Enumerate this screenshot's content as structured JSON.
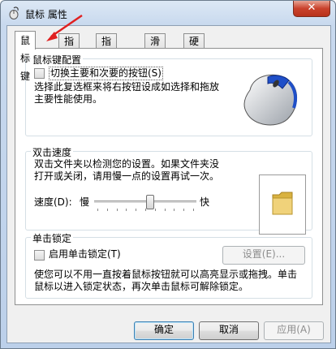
{
  "window": {
    "title": "鼠标 属性",
    "close_label": "✕"
  },
  "tabs": [
    {
      "label": "鼠标键",
      "active": true
    },
    {
      "label": "指针",
      "active": false
    },
    {
      "label": "指针选项",
      "active": false
    },
    {
      "label": "滑轮",
      "active": false
    },
    {
      "label": "硬件",
      "active": false
    }
  ],
  "button_config": {
    "legend": "鼠标键配置",
    "swap_label": "切换主要和次要的按钮(S)",
    "swap_checked": false,
    "description": [
      "选择此复选框来将右按钮设成如选择和拖放",
      "主要性能使用。"
    ]
  },
  "double_click": {
    "legend": "双击速度",
    "description": [
      "双击文件夹以检测您的设置。如果文件夹没",
      "打开或关闭，请用慢一点的设置再试一次。"
    ],
    "speed_label": "速度(D):",
    "slow_label": "慢",
    "fast_label": "快",
    "speed_level": 0.55
  },
  "click_lock": {
    "legend": "单击锁定",
    "enable_label": "启用单击锁定(T)",
    "enable_checked": false,
    "settings_label": "设置(E)...",
    "description": [
      "使您可以不用一直按着鼠标按钮就可以高亮显示或拖拽。单击",
      "鼠标以进入锁定状态，再次单击鼠标可解除锁定。"
    ]
  },
  "footer": {
    "ok_label": "确定",
    "cancel_label": "取消",
    "apply_label": "应用(A)"
  },
  "colors": {
    "annotation_arrow": "#e02020",
    "folder": "#e8c45a"
  }
}
